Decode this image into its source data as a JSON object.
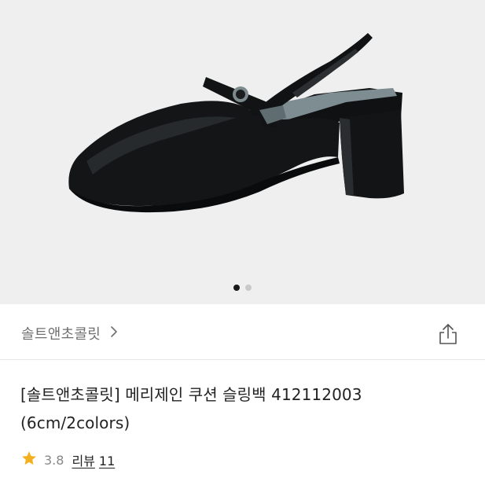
{
  "carousel": {
    "image_alt": "black mary jane slingback heel",
    "dots": [
      {
        "active": true
      },
      {
        "active": false
      }
    ]
  },
  "brand": {
    "name": "솔트앤초콜릿",
    "chevron_icon": "chevron-right-icon"
  },
  "share": {
    "icon": "share-icon"
  },
  "product": {
    "title_line1": "[솔트앤초콜릿] 메리제인 쿠션 슬링백 412112003",
    "title_line2": "(6cm/2colors)"
  },
  "rating": {
    "star_icon": "star-icon",
    "star_color": "#f2b01e",
    "score": "3.8",
    "review_label": "리뷰",
    "review_count": "11"
  },
  "colors": {
    "hero_bg": "#efefef",
    "dot_active": "#1a1a1a",
    "dot_inactive": "#c9c9c9"
  }
}
